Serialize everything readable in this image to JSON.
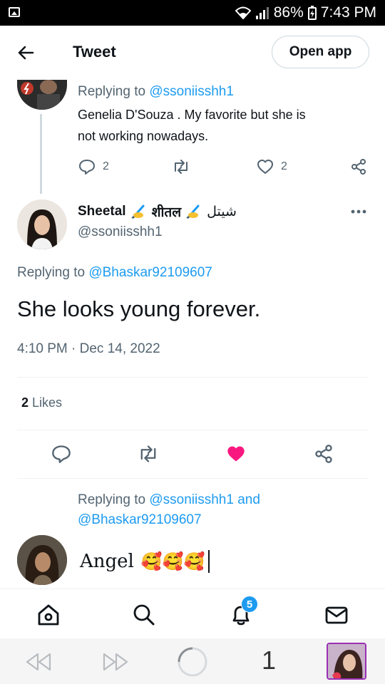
{
  "status_bar": {
    "battery": "86%",
    "time": "7:43 PM"
  },
  "header": {
    "title": "Tweet",
    "open_app_label": "Open app"
  },
  "parent_tweet": {
    "replying_prefix": "Replying to",
    "replying_to": "@ssoniisshh1",
    "text_line1": "Genelia D'Souza . My favorite but she is",
    "text_line2": "not working nowadays.",
    "reply_count": "2",
    "like_count": "2"
  },
  "main_tweet": {
    "display_name": "Sheetal",
    "name_hindi": "शीतल",
    "name_urdu": "شیتل",
    "handle": "@ssoniisshh1",
    "replying_prefix": "Replying to",
    "replying_to": "@Bhaskar92109607",
    "text": "She looks young forever.",
    "timestamp": "4:10 PM · Dec 14, 2022",
    "likes_count": "2",
    "likes_label": "Likes"
  },
  "compose": {
    "replying_prefix": "Replying to",
    "mention1": "@ssoniisshh1",
    "conjunction": "and",
    "mention2": "@Bhaskar92109607",
    "text": "Angel",
    "emojis": "🥰🥰🥰"
  },
  "bottom_nav": {
    "notifications_badge": "5"
  },
  "media_bar": {
    "counter": "1"
  },
  "colors": {
    "accent": "#1d9bf0",
    "like": "#f91880",
    "muted": "#536471",
    "text": "#0f1419"
  }
}
